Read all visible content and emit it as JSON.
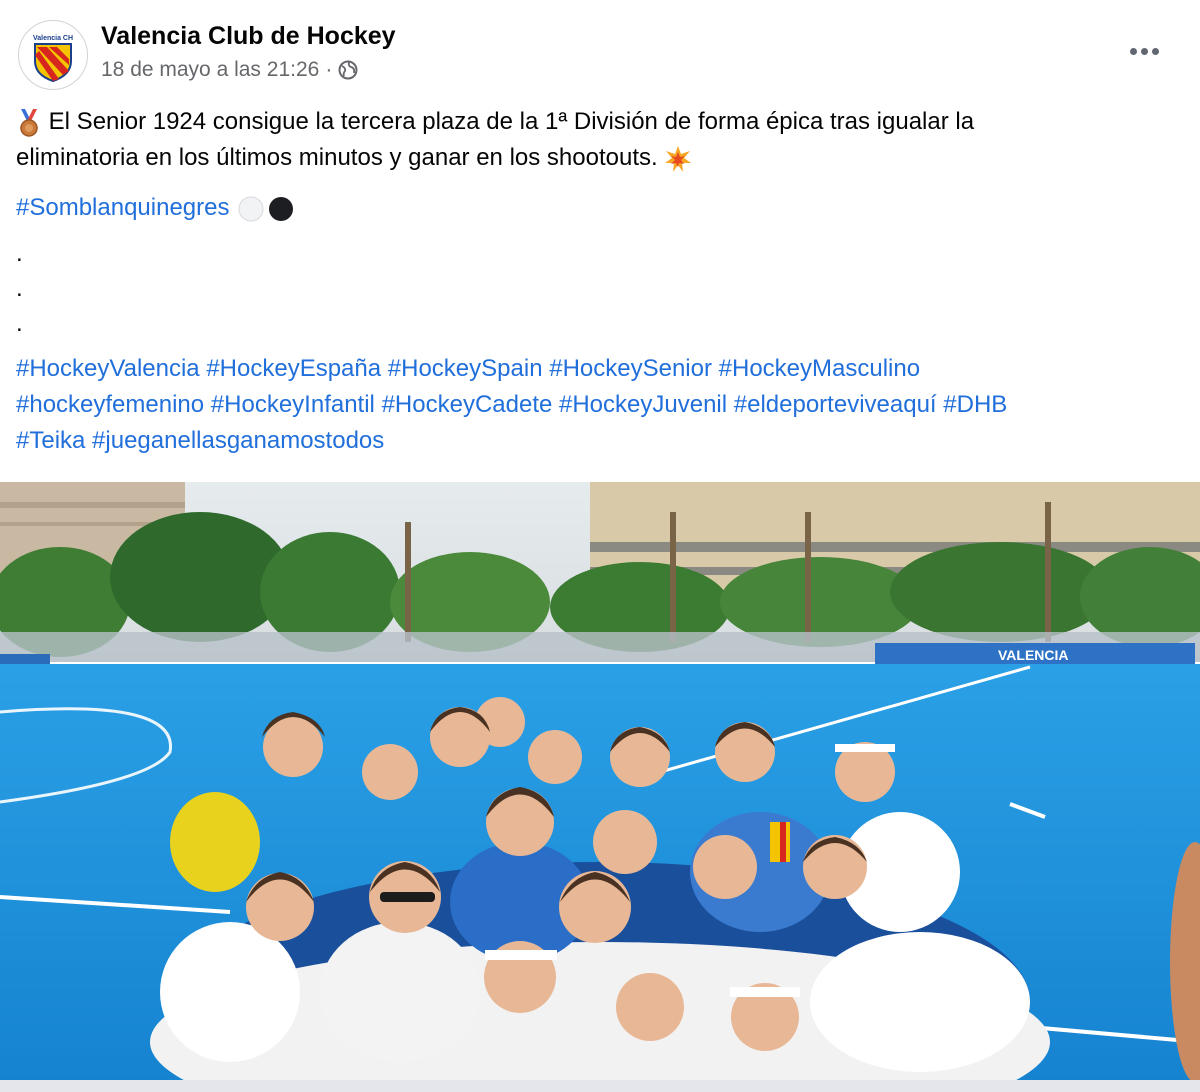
{
  "post": {
    "page_name": "Valencia Club de Hockey",
    "avatar_text": "Valencia CH",
    "timestamp": "18 de mayo a las 21:26",
    "separator": "·",
    "audience_icon": "globe-icon",
    "more_icon": "more-horizontal-icon"
  },
  "body": {
    "line1": "El Senior 1924 consigue la tercera plaza de la 1ª División de forma épica tras igualar la",
    "line2": "eliminatoria en los últimos minutos y ganar en los shootouts.",
    "medal_icon": "bronze-medal-emoji",
    "collision_icon": "collision-emoji",
    "hashtag_main": "#Somblanquinegres",
    "circle_icons": [
      "white-circle-emoji",
      "black-circle-emoji"
    ],
    "dots": [
      ".",
      ".",
      "."
    ],
    "hashtags_row1": [
      "#HockeyValencia",
      "#HockeyEspaña",
      "#HockeySpain",
      "#HockeySenior",
      "#HockeyMasculino"
    ],
    "hashtags_row2": [
      "#hockeyfemenino",
      "#HockeyInfantil",
      "#HockeyCadete",
      "#HockeyJuvenil",
      "#eldeporteviveaquí",
      "#DHB"
    ],
    "hashtags_row3": [
      "#Teika",
      "#jueganellasganamostodos"
    ]
  },
  "photo": {
    "banner_text": "VALENCIA",
    "colors": {
      "pitch": "#1f97e0",
      "sky": "#e9eef1",
      "link": "#216fdb"
    }
  }
}
